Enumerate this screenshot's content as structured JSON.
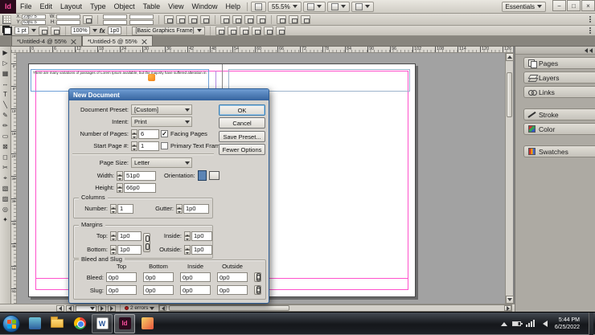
{
  "colors": {
    "title_bar_blue": "#35639e",
    "margin_guide_pink": "#ff52cc",
    "column_guide_violet": "#b48ce0",
    "error_red": "#cc2222",
    "indesign_brand_pink": "#ff4f9e"
  },
  "app_bar": {
    "logo": "Id",
    "menus": [
      "File",
      "Edit",
      "Layout",
      "Type",
      "Object",
      "Table",
      "View",
      "Window",
      "Help"
    ],
    "zoom_level": "55.5%",
    "workspace": "Essentials",
    "window_buttons": [
      {
        "name": "minimize",
        "glyph": "−"
      },
      {
        "name": "maximize",
        "glyph": "□"
      },
      {
        "name": "close",
        "glyph": "×"
      }
    ]
  },
  "control_bar": {
    "x_label": "X:",
    "x_value": "23p7.5",
    "y_label": "Y:",
    "y_value": "63p1.5",
    "w_label": "W:",
    "w_value": "",
    "h_label": "H:",
    "h_value": ""
  },
  "control_bar2": {
    "stroke_weight": "1 pt",
    "opacity": "100%",
    "corner_radius": "1p0",
    "object_style": "[Basic Graphics Frame]",
    "fx_label": "fx"
  },
  "tabs": [
    {
      "label": "*Untitled-4 @ 55%"
    },
    {
      "label": "*Untitled-5 @ 55%"
    }
  ],
  "ruler_h": [
    "0",
    "6",
    "12",
    "18",
    "24",
    "30",
    "36",
    "42",
    "48",
    "54",
    "60",
    "66",
    "72",
    "78",
    "84",
    "90",
    "96",
    "102",
    "108",
    "114",
    "120",
    "126"
  ],
  "ruler_v": [
    "0",
    "6",
    "12",
    "18",
    "24",
    "30",
    "36",
    "42",
    "48",
    "54",
    "60"
  ],
  "tools": [
    "▶",
    "▷",
    "▦",
    "↔",
    "T",
    "╲",
    "✎",
    "✏",
    "▭",
    "⊠",
    "◻",
    "✂",
    "⌖",
    "▧",
    "▨",
    "◎",
    "✦"
  ],
  "document": {
    "lorem_text": "There are many variations of passages of Lorem Ipsum available, but the majority have suffered alteration in"
  },
  "dialog": {
    "title": "New Document",
    "document_preset_label": "Document Preset:",
    "document_preset_value": "[Custom]",
    "intent_label": "Intent:",
    "intent_value": "Print",
    "number_of_pages_label": "Number of Pages:",
    "number_of_pages_value": "6",
    "facing_pages_label": "Facing Pages",
    "facing_pages_check": "✓",
    "start_page_label": "Start Page #:",
    "start_page_value": "1",
    "primary_text_frame_label": "Primary Text Frame",
    "primary_text_frame_check": "",
    "page_size_label": "Page Size:",
    "page_size_value": "Letter",
    "width_label": "Width:",
    "width_value": "51p0",
    "height_label": "Height:",
    "height_value": "66p0",
    "orientation_label": "Orientation:",
    "columns_title": "Columns",
    "columns_number_label": "Number:",
    "columns_number_value": "1",
    "gutter_label": "Gutter:",
    "gutter_value": "1p0",
    "margins_title": "Margins",
    "margin_top_label": "Top:",
    "margin_top_value": "1p0",
    "margin_bottom_label": "Bottom:",
    "margin_bottom_value": "1p0",
    "margin_inside_label": "Inside:",
    "margin_inside_value": "1p0",
    "margin_outside_label": "Outside:",
    "margin_outside_value": "1p0",
    "bleed_slug_title": "Bleed and Slug",
    "bleed_slug_headers": [
      "Top",
      "Bottom",
      "Inside",
      "Outside"
    ],
    "bleed_label": "Bleed:",
    "bleed_values": [
      "0p0",
      "0p0",
      "0p0",
      "0p0"
    ],
    "slug_label": "Slug:",
    "slug_values": [
      "0p0",
      "0p0",
      "0p0",
      "0p0"
    ],
    "ok_label": "OK",
    "cancel_label": "Cancel",
    "save_preset_label": "Save Preset...",
    "fewer_options_label": "Fewer Options"
  },
  "dock_panels": {
    "pages": "Pages",
    "layers": "Layers",
    "links": "Links",
    "stroke": "Stroke",
    "color": "Color",
    "swatches": "Swatches"
  },
  "status_bar": {
    "page_value": "",
    "errors_label": "2 errors"
  },
  "taskbar": {
    "word_glyph": "W",
    "indesign_glyph": "Id",
    "clock_time": "5:44 PM",
    "clock_date": "6/25/2022"
  }
}
